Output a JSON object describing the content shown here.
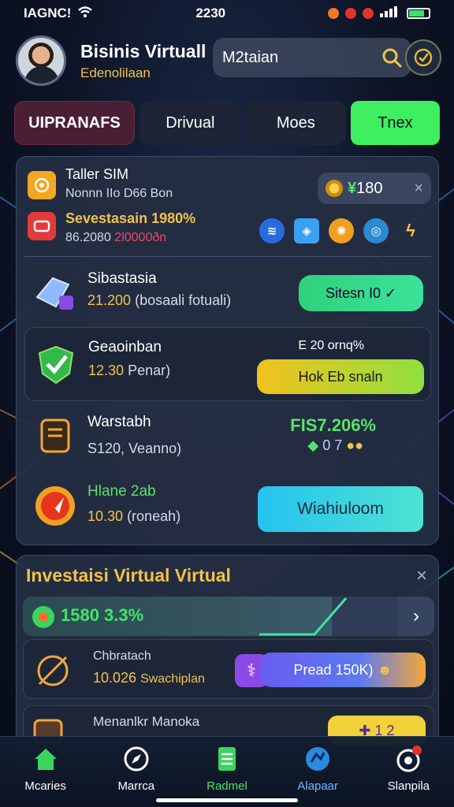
{
  "status": {
    "carrier": "IAGNC!",
    "time": "2230",
    "battery_color": "#3ee06a"
  },
  "header": {
    "title": "Bisinis Virtuall",
    "subtitle": "Edenolilaan",
    "search_text": "M2taian",
    "search_icon": "search-icon",
    "settings_icon": "check-circle-icon"
  },
  "tabs": [
    {
      "label": "UIPRANAFS"
    },
    {
      "label": "Drivual"
    },
    {
      "label": "Moes"
    },
    {
      "label": "Tnex"
    }
  ],
  "top_card": {
    "item1_title": "Taller SIM",
    "item1_sub": "Nonnn IIo  D66 Bon",
    "item2_title": "Sevestasain 1980%",
    "item2_sub_a": "86.2080",
    "item2_sub_b": "2l0000ðn",
    "balance": "180",
    "balance_prefix": "¥",
    "close": "×"
  },
  "rows": {
    "a": {
      "title": "Sibastasia",
      "value": "21.200",
      "note": "(bosaali fotuali)",
      "button": "Sitesn I0 ✓"
    },
    "b": {
      "title": "Geaoinban",
      "value": "12.30",
      "note": "Penar)",
      "right_label": "E 20 ornq%",
      "button": "Hok Eb snaln"
    },
    "c": {
      "title": "Warstabh",
      "value": "S120, Veanno)",
      "pct": "FIS7.206%",
      "sub": "0 7"
    },
    "d": {
      "title": "Hlane 2ab",
      "value": "10.30",
      "note": "(roneah)",
      "button": "Wiahiuloom"
    }
  },
  "investasi": {
    "title": "Investaisi Virtual  Virtual",
    "close": "×",
    "progress_text": "1580 3.3%",
    "progress_fraction": 0.75,
    "item1_title": "Chbratach",
    "item1_value": "10.026",
    "item1_note": "Swachiplan",
    "item1_button": "Pread 150K)",
    "item2_title": "Menanlkr Manoka",
    "item2_button": "1 2"
  },
  "nav": [
    {
      "label": "Mcaries",
      "icon": "home-icon"
    },
    {
      "label": "Marrca",
      "icon": "compass-icon"
    },
    {
      "label": "Radmel",
      "icon": "document-icon"
    },
    {
      "label": "Alapaar",
      "icon": "globe-icon"
    },
    {
      "label": "Slanpila",
      "icon": "profile-icon"
    }
  ]
}
